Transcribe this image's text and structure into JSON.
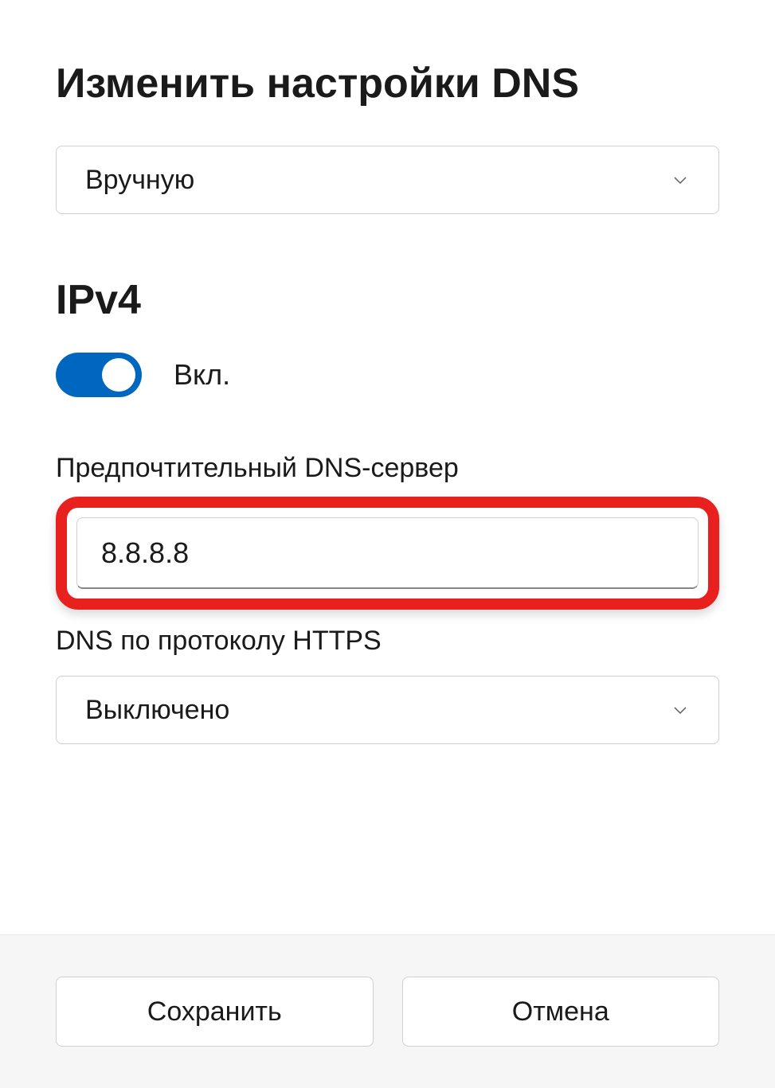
{
  "dialog": {
    "title": "Изменить настройки DNS",
    "mode_dropdown": {
      "selected": "Вручную"
    },
    "ipv4": {
      "heading": "IPv4",
      "toggle_state": "Вкл.",
      "preferred_dns": {
        "label": "Предпочтительный DNS-сервер",
        "value": "8.8.8.8"
      },
      "dns_https": {
        "label": "DNS по протоколу HTTPS",
        "selected": "Выключено"
      }
    },
    "buttons": {
      "save": "Сохранить",
      "cancel": "Отмена"
    }
  }
}
